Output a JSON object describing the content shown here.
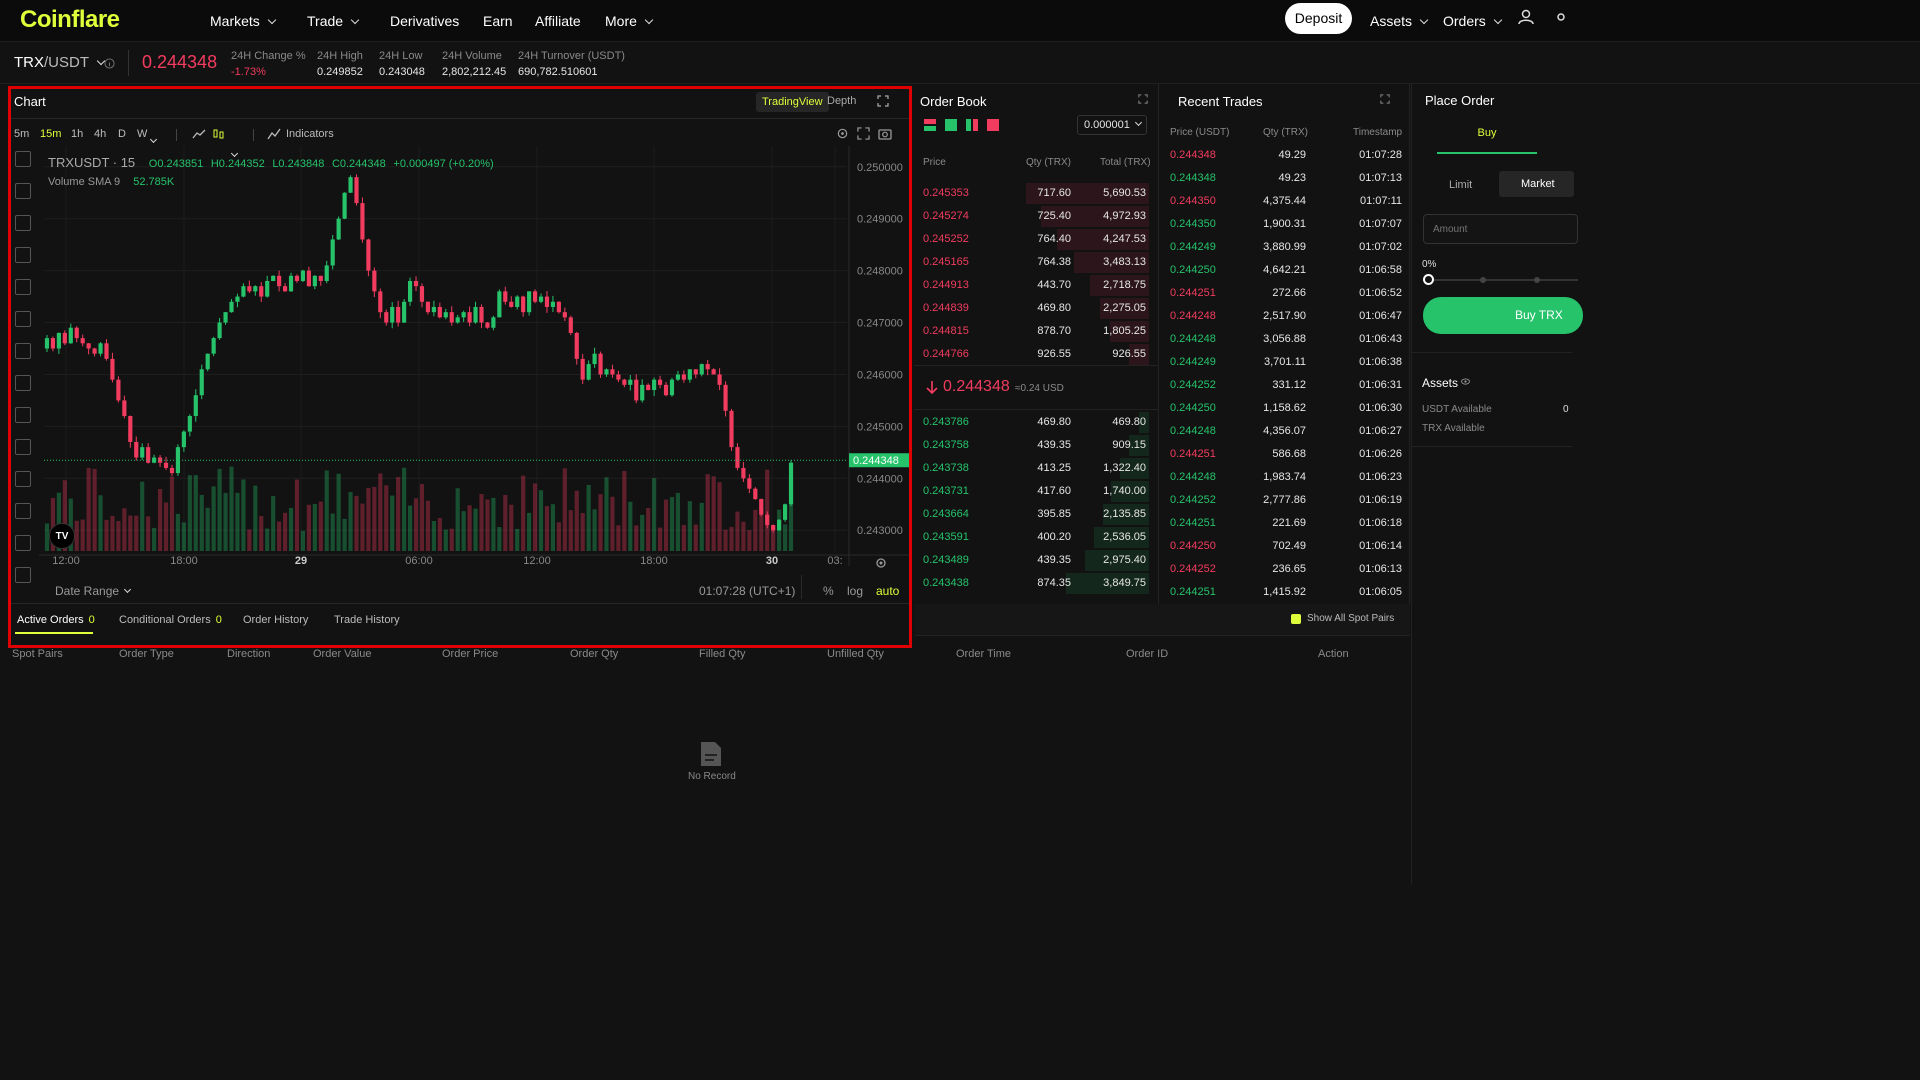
{
  "nav": {
    "logo": "Coinflare",
    "items": [
      {
        "label": "Markets",
        "dropdown": true
      },
      {
        "label": "Trade",
        "dropdown": true
      },
      {
        "label": "Derivatives",
        "dropdown": false
      },
      {
        "label": "Earn",
        "dropdown": false
      },
      {
        "label": "Affiliate",
        "dropdown": false
      },
      {
        "label": "More",
        "dropdown": true
      }
    ],
    "deposit": "Deposit",
    "assets": "Assets",
    "orders": "Orders"
  },
  "ticker": {
    "pair_base": "TRX",
    "pair_quote": "/USDT",
    "price": "0.244348",
    "stats": [
      {
        "label": "24H Change %",
        "value": "-1.73%",
        "color": "#f23c5f"
      },
      {
        "label": "24H High",
        "value": "0.249852"
      },
      {
        "label": "24H Low",
        "value": "0.243048"
      },
      {
        "label": "24H Volume",
        "value": "2,802,212.45"
      },
      {
        "label": "24H Turnover (USDT)",
        "value": "690,782.510601"
      }
    ]
  },
  "chart_panel": {
    "title": "Chart",
    "view_tabs": [
      "TradingView",
      "Depth"
    ],
    "active_view": "TradingView",
    "intervals": [
      "5m",
      "15m",
      "1h",
      "4h",
      "D",
      "W"
    ],
    "active_interval": "15m",
    "indicators_label": "Indicators",
    "legend_symbol": "TRXUSDT · 15",
    "legend_o": "O0.243851",
    "legend_h": "H0.244352",
    "legend_l": "L0.243848",
    "legend_c": "C0.244348",
    "legend_chg": "+0.000497 (+0.20%)",
    "volume_label": "Volume SMA 9",
    "volume_value": "52.785K",
    "last_price_tag": "0.244348",
    "date_range": "Date Range",
    "clock": "01:07:28 (UTC+1)",
    "scale_options": [
      "%",
      "log",
      "auto"
    ],
    "logo_text": "TV"
  },
  "chart_data": {
    "type": "candlestick",
    "symbol": "TRXUSDT",
    "interval": "15",
    "ylim": [
      0.2426,
      0.2504
    ],
    "y_ticks": [
      "0.250000",
      "0.249000",
      "0.248000",
      "0.247000",
      "0.246000",
      "0.245000",
      "0.244000",
      "0.243000"
    ],
    "x_ticks": [
      "12:00",
      "18:00",
      "29",
      "06:00",
      "12:00",
      "18:00",
      "30",
      "03:"
    ],
    "up_color": "#26c36b",
    "down_color": "#f23c5f",
    "closes": [
      0.2467,
      0.2465,
      0.2468,
      0.2466,
      0.2469,
      0.2467,
      0.2466,
      0.2465,
      0.2464,
      0.2466,
      0.2463,
      0.2459,
      0.2455,
      0.2452,
      0.2447,
      0.2444,
      0.2446,
      0.2443,
      0.2444,
      0.2443,
      0.2442,
      0.2441,
      0.2446,
      0.2449,
      0.2452,
      0.2456,
      0.2461,
      0.2464,
      0.2467,
      0.247,
      0.2472,
      0.2474,
      0.2475,
      0.2477,
      0.2476,
      0.2477,
      0.2475,
      0.2478,
      0.2479,
      0.2477,
      0.2476,
      0.2479,
      0.2478,
      0.248,
      0.2477,
      0.2479,
      0.2478,
      0.2481,
      0.2486,
      0.249,
      0.2495,
      0.2498,
      0.2493,
      0.2486,
      0.248,
      0.2476,
      0.2472,
      0.247,
      0.2473,
      0.247,
      0.2474,
      0.2478,
      0.2477,
      0.2474,
      0.2472,
      0.2473,
      0.2471,
      0.2472,
      0.247,
      0.2471,
      0.2472,
      0.247,
      0.2473,
      0.247,
      0.2469,
      0.2471,
      0.2476,
      0.2474,
      0.2473,
      0.2475,
      0.2472,
      0.2476,
      0.2474,
      0.2475,
      0.2473,
      0.2474,
      0.2472,
      0.2471,
      0.2468,
      0.2463,
      0.2459,
      0.2462,
      0.2464,
      0.246,
      0.2461,
      0.246,
      0.2459,
      0.2458,
      0.2459,
      0.2455,
      0.2458,
      0.2457,
      0.2459,
      0.2458,
      0.2456,
      0.2459,
      0.246,
      0.2459,
      0.2461,
      0.246,
      0.2462,
      0.2461,
      0.246,
      0.2458,
      0.2453,
      0.2446,
      0.2442,
      0.244,
      0.2438,
      0.2436,
      0.2433,
      0.2431,
      0.243,
      0.2432,
      0.2435,
      0.2443
    ]
  },
  "order_book": {
    "title": "Order Book",
    "precision": "0.000001",
    "headers": [
      "Price",
      "Qty (TRX)",
      "Total (TRX)"
    ],
    "asks": [
      [
        "0.245353",
        "717.60",
        "5,690.53"
      ],
      [
        "0.245274",
        "725.40",
        "4,972.93"
      ],
      [
        "0.245252",
        "764.40",
        "4,247.53"
      ],
      [
        "0.245165",
        "764.38",
        "3,483.13"
      ],
      [
        "0.244913",
        "443.70",
        "2,718.75"
      ],
      [
        "0.244839",
        "469.80",
        "2,275.05"
      ],
      [
        "0.244815",
        "878.70",
        "1,805.25"
      ],
      [
        "0.244766",
        "926.55",
        "926.55"
      ]
    ],
    "mid_price": "0.244348",
    "mid_usd": "≈0.24 USD",
    "bids": [
      [
        "0.243786",
        "469.80",
        "469.80"
      ],
      [
        "0.243758",
        "439.35",
        "909.15"
      ],
      [
        "0.243738",
        "413.25",
        "1,322.40"
      ],
      [
        "0.243731",
        "417.60",
        "1,740.00"
      ],
      [
        "0.243664",
        "395.85",
        "2,135.85"
      ],
      [
        "0.243591",
        "400.20",
        "2,536.05"
      ],
      [
        "0.243489",
        "439.35",
        "2,975.40"
      ],
      [
        "0.243438",
        "874.35",
        "3,849.75"
      ]
    ]
  },
  "recent_trades": {
    "title": "Recent Trades",
    "headers": [
      "Price (USDT)",
      "Qty (TRX)",
      "Timestamp"
    ],
    "rows": [
      [
        "0.244348",
        "49.29",
        "01:07:28",
        "red"
      ],
      [
        "0.244348",
        "49.23",
        "01:07:13",
        "green"
      ],
      [
        "0.244350",
        "4,375.44",
        "01:07:11",
        "red"
      ],
      [
        "0.244350",
        "1,900.31",
        "01:07:07",
        "green"
      ],
      [
        "0.244249",
        "3,880.99",
        "01:07:02",
        "green"
      ],
      [
        "0.244250",
        "4,642.21",
        "01:06:58",
        "green"
      ],
      [
        "0.244251",
        "272.66",
        "01:06:52",
        "red"
      ],
      [
        "0.244248",
        "2,517.90",
        "01:06:47",
        "red"
      ],
      [
        "0.244248",
        "3,056.88",
        "01:06:43",
        "green"
      ],
      [
        "0.244249",
        "3,701.11",
        "01:06:38",
        "green"
      ],
      [
        "0.244252",
        "331.12",
        "01:06:31",
        "green"
      ],
      [
        "0.244250",
        "1,158.62",
        "01:06:30",
        "green"
      ],
      [
        "0.244248",
        "4,356.07",
        "01:06:27",
        "green"
      ],
      [
        "0.244251",
        "586.68",
        "01:06:26",
        "red"
      ],
      [
        "0.244248",
        "1,983.74",
        "01:06:23",
        "green"
      ],
      [
        "0.244252",
        "2,777.86",
        "01:06:19",
        "green"
      ],
      [
        "0.244251",
        "221.69",
        "01:06:18",
        "green"
      ],
      [
        "0.244250",
        "702.49",
        "01:06:14",
        "red"
      ],
      [
        "0.244252",
        "236.65",
        "01:06:13",
        "red"
      ],
      [
        "0.244251",
        "1,415.92",
        "01:06:05",
        "green"
      ]
    ]
  },
  "place_order": {
    "title": "Place Order",
    "side": "Buy",
    "types": [
      "Limit",
      "Market"
    ],
    "active_type": "Market",
    "amount_placeholder": "Amount",
    "percent": "0%",
    "buy_button": "Buy TRX",
    "assets_title": "Assets",
    "usdt_available": "USDT Available",
    "usdt_value": "0",
    "trx_available": "TRX Available"
  },
  "orders_panel": {
    "tabs": [
      {
        "label": "Active Orders",
        "count": "0"
      },
      {
        "label": "Conditional Orders",
        "count": "0"
      },
      {
        "label": "Order History",
        "count": ""
      },
      {
        "label": "Trade History",
        "count": ""
      }
    ],
    "show_all": "Show All Spot Pairs",
    "columns": [
      "Spot Pairs",
      "Order Type",
      "Direction",
      "Order Value",
      "Order Price",
      "Order Qty",
      "Filled Qty",
      "Unfilled Qty",
      "Order Time",
      "Order ID",
      "Action"
    ],
    "empty_text": "No Record"
  }
}
